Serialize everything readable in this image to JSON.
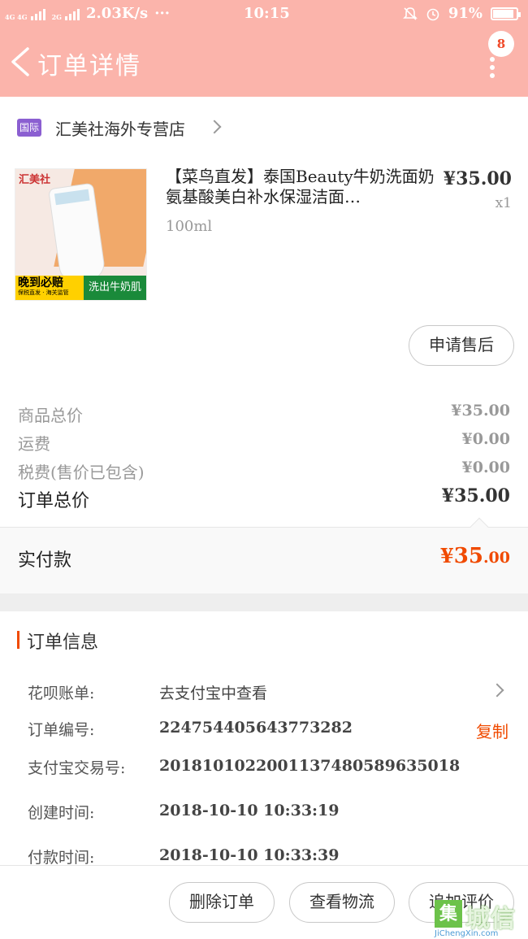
{
  "status_bar": {
    "network": "4G 4G",
    "network2": "2G",
    "speed": "2.03K/s",
    "dots": "···",
    "time": "10:15",
    "battery": "91%",
    "battery_level": 0.91
  },
  "nav": {
    "title": "订单详情",
    "badge_count": "8"
  },
  "shop": {
    "tag": "国际",
    "name": "汇美社海外专营店"
  },
  "product": {
    "image_logo": "汇美社",
    "image_left_text": "晚到必赔",
    "image_left_small": "保税直发 · 海关监管",
    "image_right_text": "洗出牛奶肌",
    "title": "【菜鸟直发】泰国Beauty牛奶洗面奶氨基酸美白补水保湿洁面…",
    "spec": "100ml",
    "price": "¥35.00",
    "qty": "x1",
    "after_sale_label": "申请售后"
  },
  "summary": {
    "goods_total_label": "商品总价",
    "goods_total": "¥35.00",
    "shipping_label": "运费",
    "shipping": "¥0.00",
    "tax_label": "税费(售价已包含)",
    "tax": "¥0.00",
    "order_total_label": "订单总价",
    "order_total": "¥35.00",
    "paid_label": "实付款",
    "paid_currency": "¥",
    "paid_int": "35",
    "paid_dec": ".00"
  },
  "order_info": {
    "title": "订单信息",
    "huabei_label": "花呗账单:",
    "huabei_value": "去支付宝中查看",
    "order_no_label": "订单编号:",
    "order_no": "224754405643773282",
    "copy_label": "复制",
    "alipay_no_label": "支付宝交易号:",
    "alipay_no": "2018101022001137480589635018",
    "created_label": "创建时间:",
    "created": "2018-10-10 10:33:19",
    "paid_time_label": "付款时间:",
    "paid_time": "2018-10-10 10:33:39"
  },
  "actions": {
    "delete": "删除订单",
    "logistics": "查看物流",
    "review": "追加评价"
  },
  "watermark": {
    "box": "集",
    "cn": "城信",
    "url": "JiChengXin.com"
  },
  "colors": {
    "header": "#fbb4ab",
    "accent": "#f04a00",
    "intl_tag": "#8b5fd1"
  }
}
